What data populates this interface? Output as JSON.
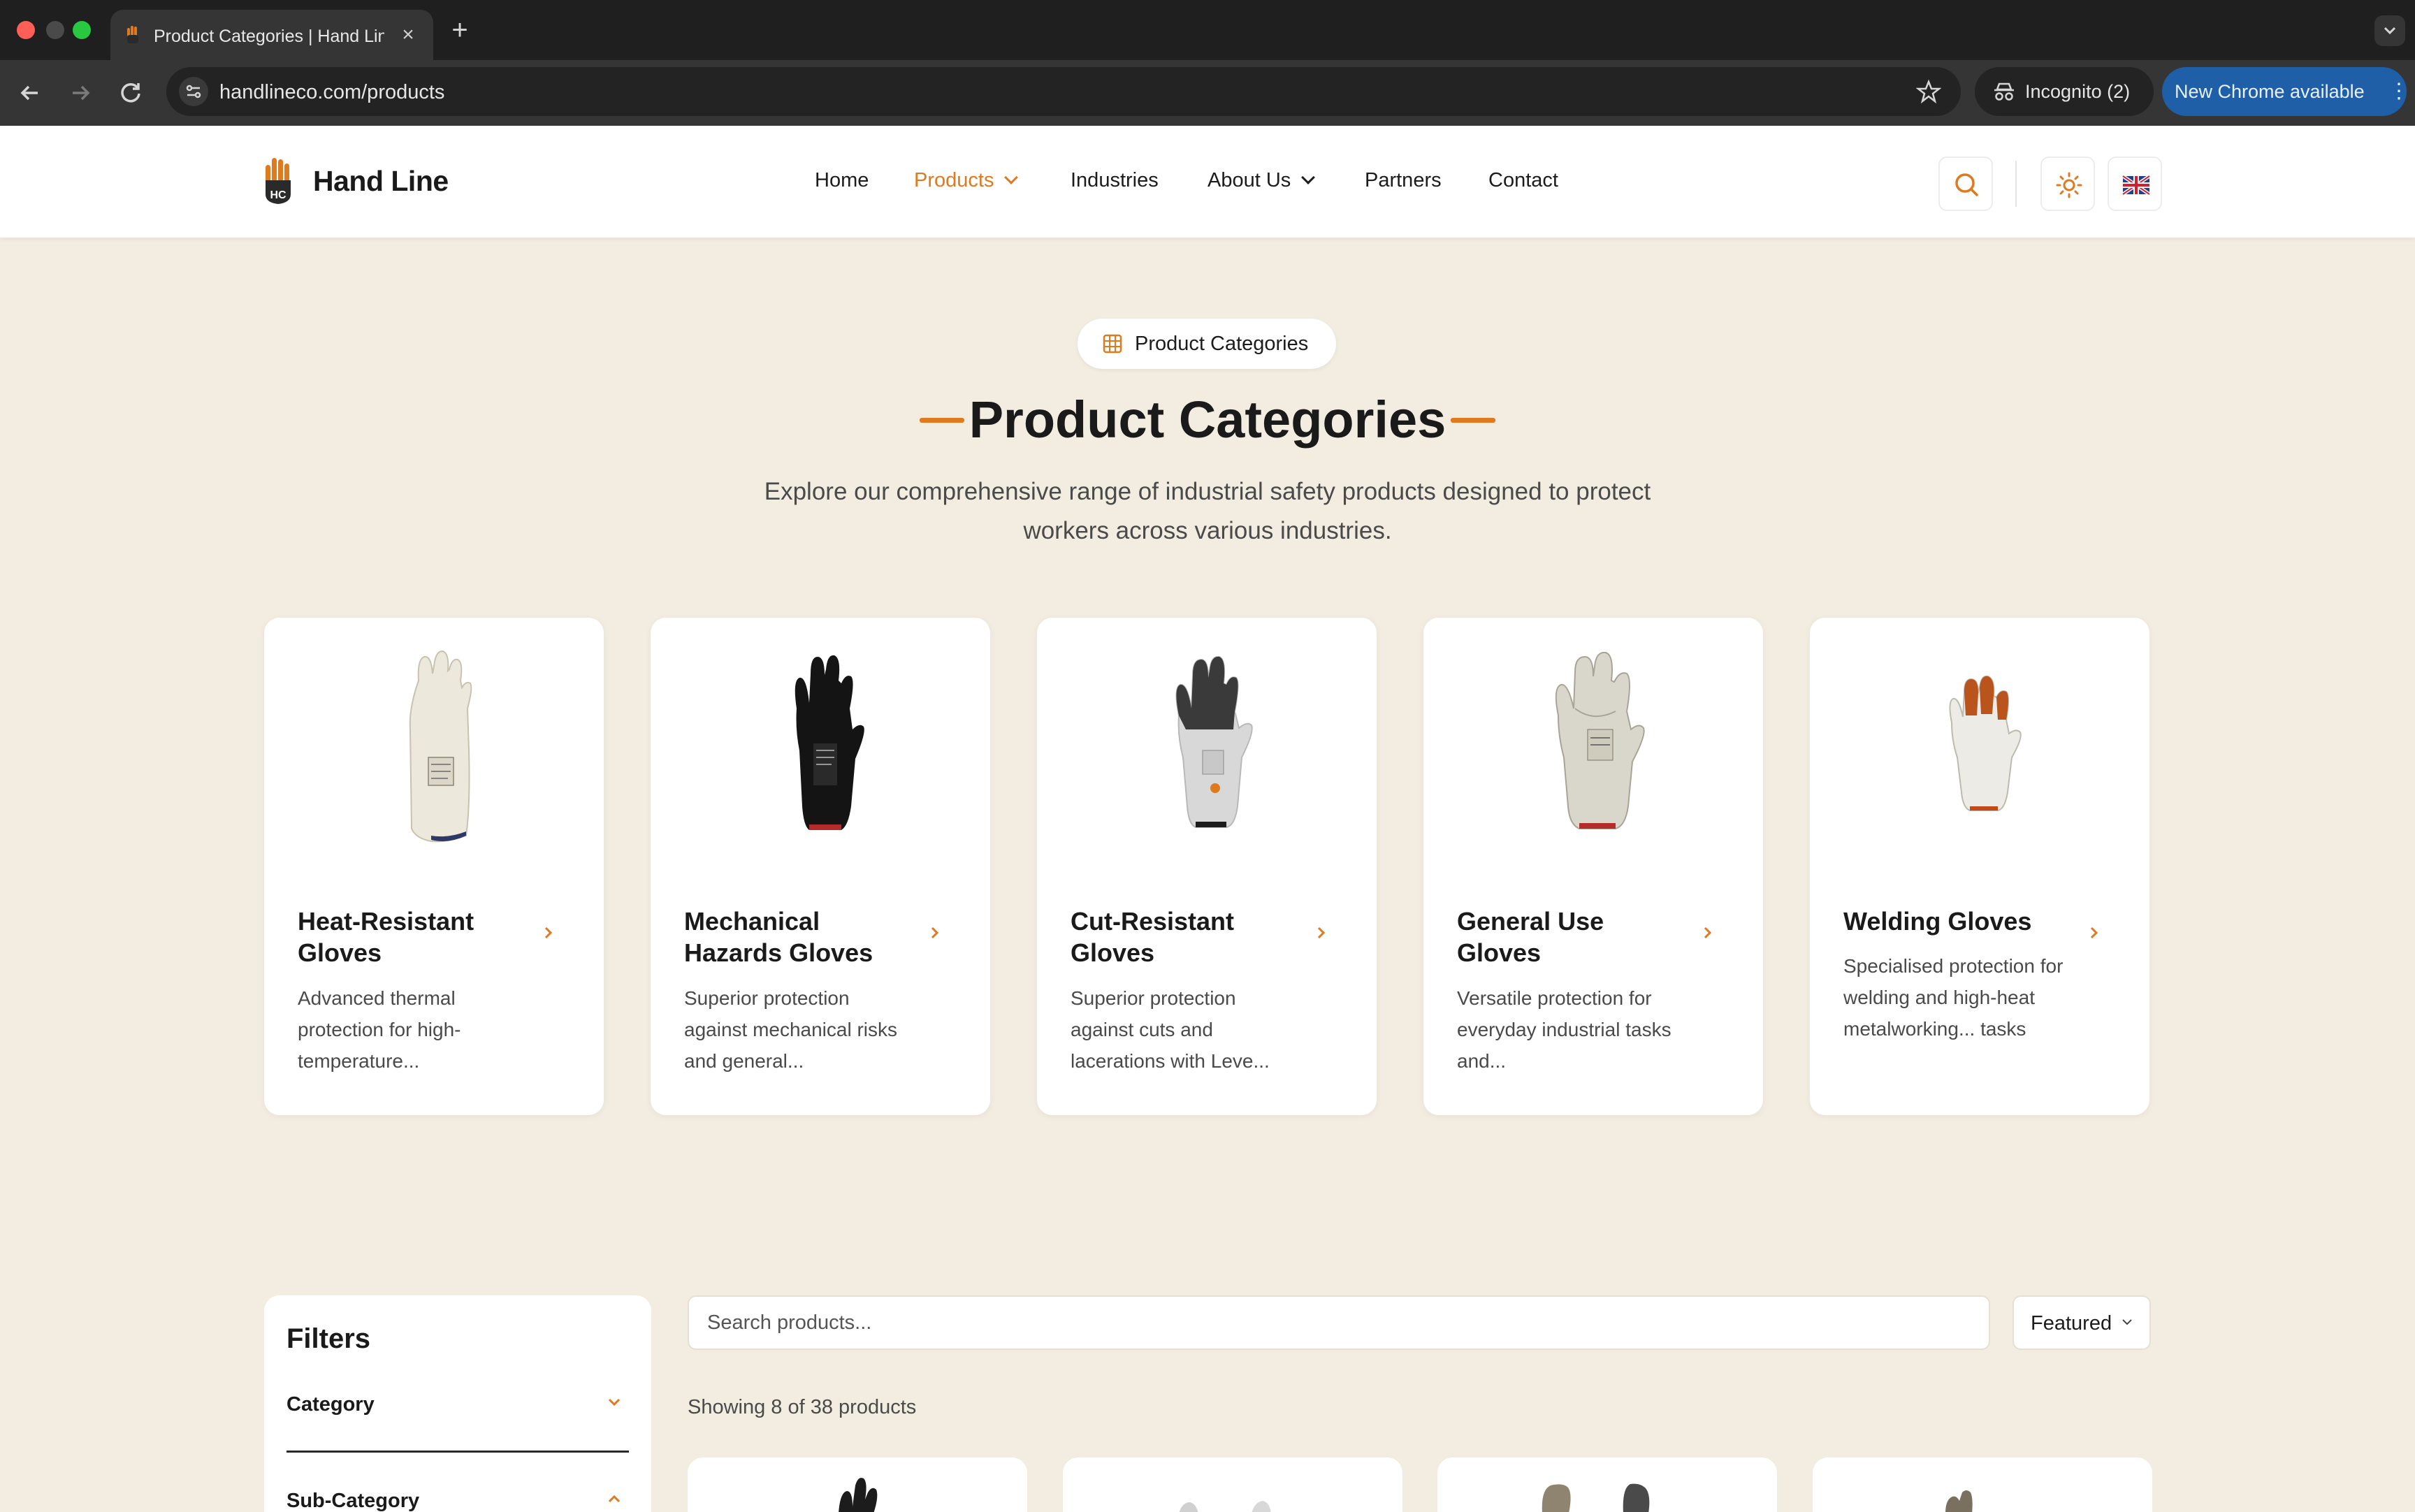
{
  "browser": {
    "tab_title": "Product Categories | Hand Line",
    "url": "handlineco.com/products",
    "incognito_label": "Incognito (2)",
    "update_label": "New Chrome available"
  },
  "header": {
    "logo_text": "Hand Line",
    "nav": [
      {
        "label": "Home"
      },
      {
        "label": "Products"
      },
      {
        "label": "Industries"
      },
      {
        "label": "About Us"
      },
      {
        "label": "Partners"
      },
      {
        "label": "Contact"
      }
    ],
    "accent_color": "#e07a1f"
  },
  "hero": {
    "pill_label": "Product Categories",
    "title": "Product Categories",
    "subtitle_line1": "Explore our comprehensive range of industrial safety products designed to protect",
    "subtitle_line2": "workers across various industries."
  },
  "categories": [
    {
      "name": "Heat-Resistant Gloves",
      "desc": "Advanced thermal protection for high-temperature..."
    },
    {
      "name": "Mechanical Hazards Gloves",
      "desc": "Superior protection against mechanical risks and general..."
    },
    {
      "name": "Cut-Resistant Gloves",
      "desc": "Superior protection against cuts and lacerations with Leve..."
    },
    {
      "name": "General Use Gloves",
      "desc": "Versatile protection for everyday industrial tasks and..."
    },
    {
      "name": "Welding Gloves",
      "desc": "Specialised protection for welding and high-heat metalworking... tasks"
    }
  ],
  "filters": {
    "title": "Filters",
    "category_label": "Category",
    "subcategory_label": "Sub-Category"
  },
  "products": {
    "search_placeholder": "Search products...",
    "sort_label": "Featured",
    "count_text": "Showing 8 of 38 products"
  }
}
